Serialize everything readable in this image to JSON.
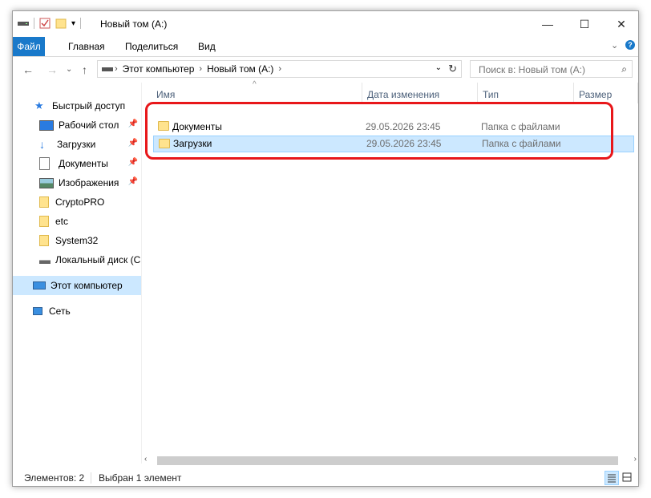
{
  "window": {
    "title": "Новый том (A:)",
    "minimize": "—",
    "maximize": "☐",
    "close": "✕"
  },
  "ribbon": {
    "tabs": [
      "Файл",
      "Главная",
      "Поделиться",
      "Вид"
    ],
    "expand": "⌄",
    "help": "?"
  },
  "nav": {
    "back": "←",
    "forward": "→",
    "recent": "⌄",
    "up": "↑",
    "breadcrumb": [
      "Этот компьютер",
      "Новый том (A:)"
    ],
    "search_placeholder": "Поиск в: Новый том (A:)"
  },
  "sidebar": {
    "items": [
      {
        "label": "Быстрый доступ",
        "icon": "star-icon"
      },
      {
        "label": "Рабочий стол",
        "icon": "desktop-icon",
        "pinned": true
      },
      {
        "label": "Загрузки",
        "icon": "download-icon",
        "pinned": true
      },
      {
        "label": "Документы",
        "icon": "document-icon",
        "pinned": true
      },
      {
        "label": "Изображения",
        "icon": "pictures-icon",
        "pinned": true
      },
      {
        "label": "CryptoPRO",
        "icon": "folder-icon"
      },
      {
        "label": "etc",
        "icon": "folder-icon"
      },
      {
        "label": "System32",
        "icon": "folder-icon"
      },
      {
        "label": "Локальный диск (C",
        "icon": "drive-icon"
      },
      {
        "label": "Этот компьютер",
        "icon": "computer-icon",
        "selected": true
      },
      {
        "label": "Сеть",
        "icon": "network-icon"
      }
    ]
  },
  "table": {
    "columns": [
      "Имя",
      "Дата изменения",
      "Тип",
      "Размер"
    ],
    "sort_indicator": "^",
    "rows": [
      {
        "name": "Документы",
        "date": "29.05.2026 23:45",
        "type": "Папка с файлами",
        "size": ""
      },
      {
        "name": "Загрузки",
        "date": "29.05.2026 23:45",
        "type": "Папка с файлами",
        "size": "",
        "selected": true
      }
    ]
  },
  "status": {
    "count": "Элементов: 2",
    "selection": "Выбран 1 элемент"
  },
  "colors": {
    "accent": "#1979ca",
    "selection": "#cce8ff",
    "highlight": "#e8171a"
  }
}
